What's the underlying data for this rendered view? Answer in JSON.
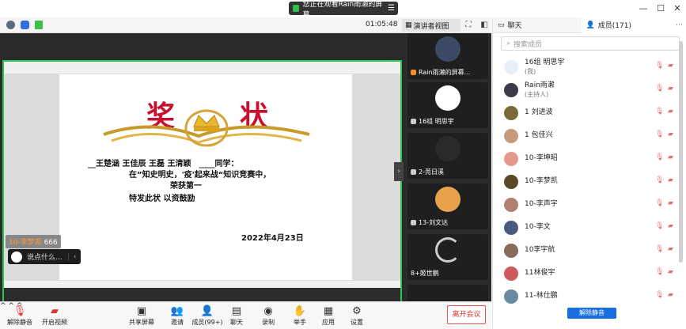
{
  "title_bar": {
    "share_status": "您正在观看Rain雨濑的屏幕",
    "menu_glyph": "☰",
    "window_controls": [
      "—",
      "☐",
      "✕"
    ]
  },
  "toolbar": {
    "timer": "01:05:48",
    "view_mode": "演讲者视图"
  },
  "shared_document": {
    "title_left": "奖",
    "title_right": "状",
    "line1": "__王楚涵 王佳辰 王磊 王清颖　____同学：",
    "line2": "在”知史明史，'疫'起来战“知识竞赛中，",
    "line3": "荣获第一",
    "line4": "特发此状 以资鼓励",
    "date": "2022年4月23日"
  },
  "chat_overlay": {
    "sender": "10-李梦凯",
    "message": "666",
    "input_placeholder": "说点什么...",
    "collapse_glyph": "‹"
  },
  "video_tiles": [
    {
      "label": "Rain雨濑的屏幕..."
    },
    {
      "label": "16组 明思宇"
    },
    {
      "label": "2-莞日溪"
    },
    {
      "label": "13-刘文达"
    },
    {
      "label": "8+姬世鹏"
    }
  ],
  "panel": {
    "chat_tab": "聊天",
    "members_tab": "成员(171)",
    "more_glyph": "⋯",
    "search_placeholder": "搜索成员",
    "unmute_all": "解除静音"
  },
  "members": [
    {
      "name": "16组 明思宇",
      "role": "(我)",
      "color": "#e6eef7"
    },
    {
      "name": "Rain雨濑",
      "role": "(主持人)",
      "color": "#3a3a4a"
    },
    {
      "name": "1 刘进波",
      "role": "",
      "color": "#7a6a3a"
    },
    {
      "name": "1 包佳兴",
      "role": "",
      "color": "#c79a7a"
    },
    {
      "name": "10-李坤昭",
      "role": "",
      "color": "#e49a8a"
    },
    {
      "name": "10-李梦凯",
      "role": "",
      "color": "#5a4a2a"
    },
    {
      "name": "10-李声宇",
      "role": "",
      "color": "#b08070"
    },
    {
      "name": "10-李文",
      "role": "",
      "color": "#4a5a7a"
    },
    {
      "name": "10李宇航",
      "role": "",
      "color": "#8a6a5a"
    },
    {
      "name": "11林俊宇",
      "role": "",
      "color": "#d05a5a"
    },
    {
      "name": "11-林仕鹏",
      "role": "",
      "color": "#6a8aa0"
    }
  ],
  "bottom_bar": {
    "mute": "解除静音",
    "video": "开启视频",
    "share": "共享屏幕",
    "invite": "邀请",
    "members": "成员(99+)",
    "chat": "聊天",
    "record": "录制",
    "raise_hand": "举手",
    "apps": "应用",
    "settings": "设置",
    "leave": "离开会议"
  },
  "colors": {
    "accent_green": "#30c457",
    "award_red": "#c8102e",
    "leave_red": "#e03030",
    "primary_blue": "#1a6fe0"
  }
}
